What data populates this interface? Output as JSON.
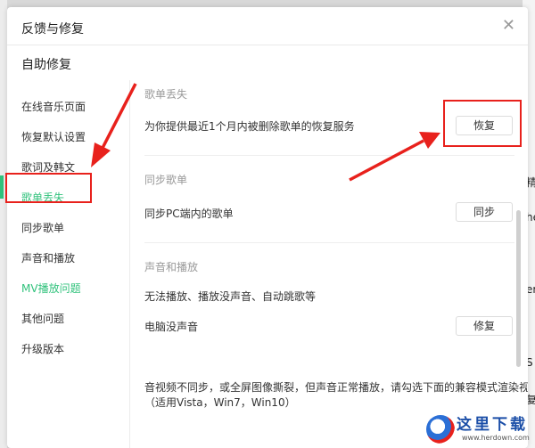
{
  "dialog": {
    "title": "反馈与修复",
    "section_title": "自助修复"
  },
  "sidebar": {
    "items": [
      {
        "label": "在线音乐页面"
      },
      {
        "label": "恢复默认设置"
      },
      {
        "label": "歌词及韩文"
      },
      {
        "label": "歌单丢失"
      },
      {
        "label": "同步歌单"
      },
      {
        "label": "声音和播放"
      },
      {
        "label": "MV播放问题"
      },
      {
        "label": "其他问题"
      },
      {
        "label": "升级版本"
      }
    ]
  },
  "content": {
    "playlist_lost": {
      "heading": "歌单丢失",
      "description": "为你提供最近1个月内被删除歌单的恢复服务",
      "button": "恢复"
    },
    "sync_playlist": {
      "heading": "同步歌单",
      "description": "同步PC端内的歌单",
      "button": "同步"
    },
    "sound_playback": {
      "heading": "声音和播放",
      "description": "无法播放、播放没声音、自动跳歌等",
      "row_label": "电脑没声音",
      "button": "修复",
      "video_note_line1": "音视频不同步，或全屏图像撕裂，但声音正常播放，请勾选下面的兼容模式渲染视频",
      "video_note_line2": "（适用Vista，Win7，Win10）"
    }
  },
  "background_fragments": [
    "精",
    "he",
    "er",
    "S",
    "复"
  ],
  "watermark": {
    "title": "这里下载",
    "url": "www.herdown.com"
  },
  "colors": {
    "accent": "#31c27c",
    "annotation": "#e8211c"
  }
}
